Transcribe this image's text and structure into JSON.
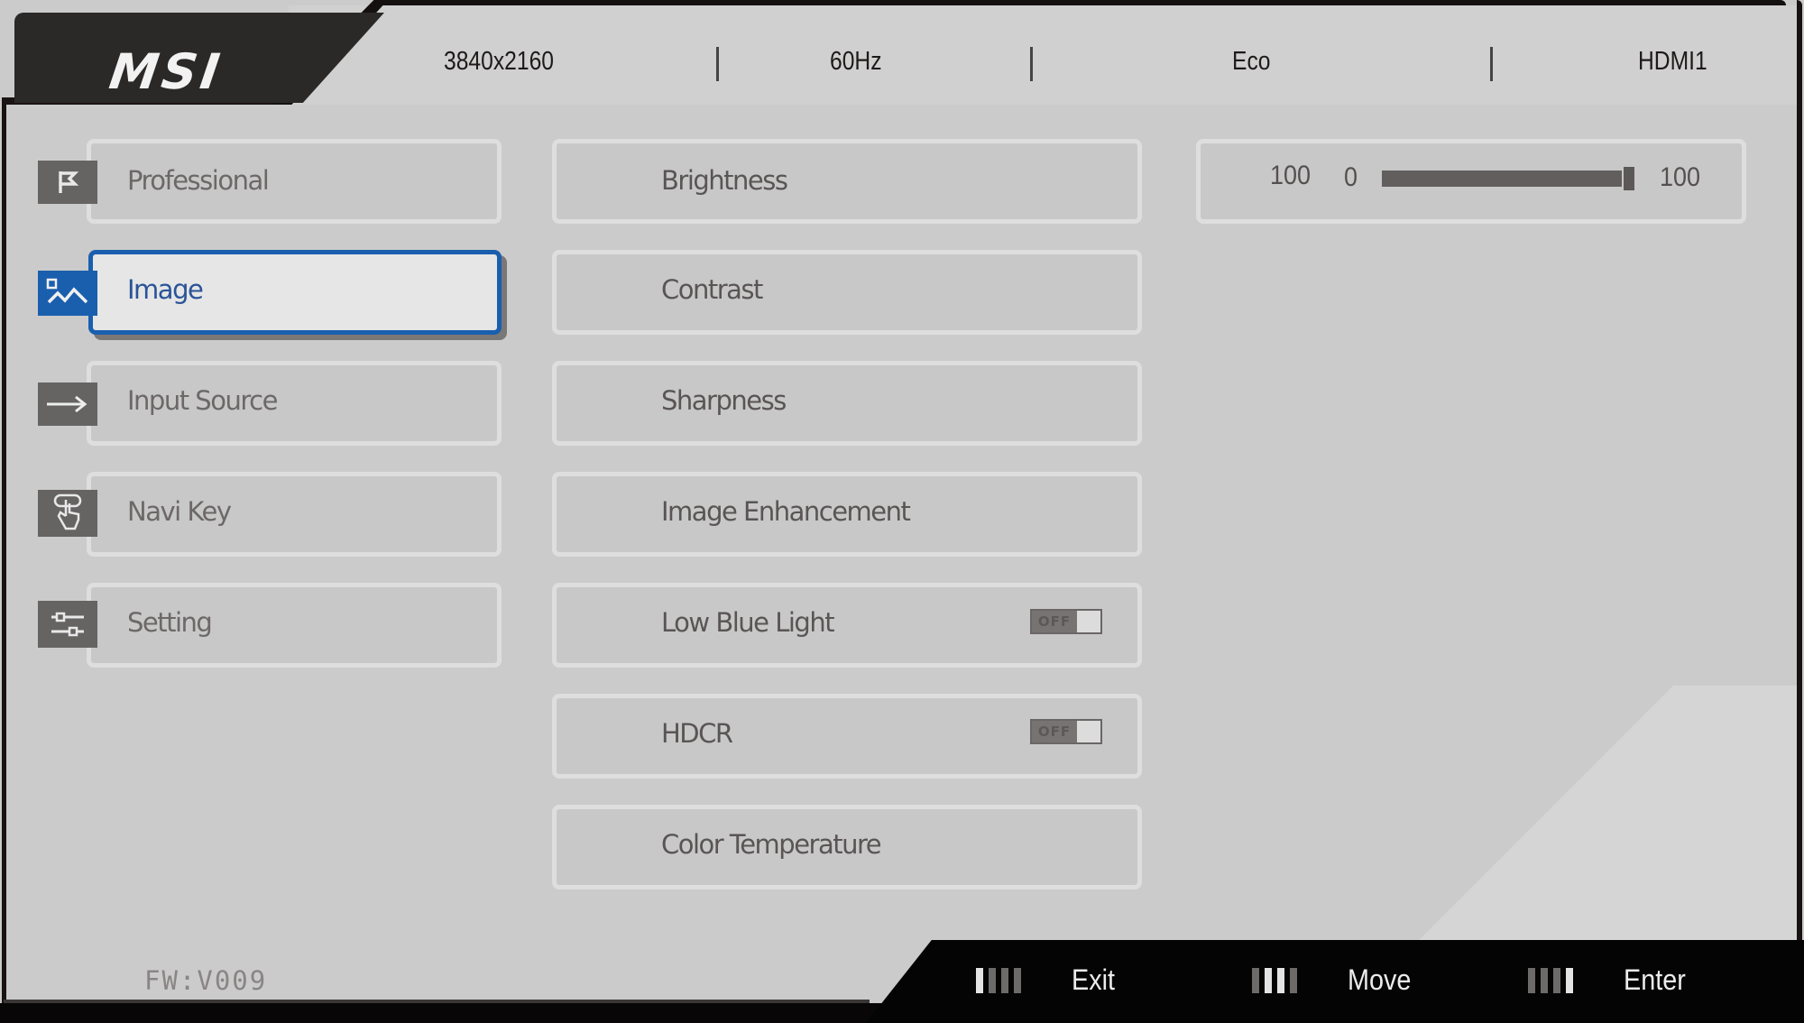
{
  "brand": {
    "logo_text": "MSI",
    "accent_color": "#1a5fae"
  },
  "status_bar": {
    "resolution": "3840x2160",
    "refresh_rate": "60Hz",
    "mode": "Eco",
    "input": "HDMI1"
  },
  "categories": [
    {
      "label": "Professional",
      "icon": "flag-icon",
      "active": false
    },
    {
      "label": "Image",
      "icon": "image-icon",
      "active": true
    },
    {
      "label": "Input Source",
      "icon": "arrow-right-icon",
      "active": false
    },
    {
      "label": "Navi Key",
      "icon": "touch-key-icon",
      "active": false
    },
    {
      "label": "Setting",
      "icon": "sliders-icon",
      "active": false
    }
  ],
  "submenu": [
    {
      "label": "Brightness"
    },
    {
      "label": "Contrast"
    },
    {
      "label": "Sharpness"
    },
    {
      "label": "Image Enhancement"
    },
    {
      "label": "Low Blue Light",
      "toggle": "OFF"
    },
    {
      "label": "HDCR",
      "toggle": "OFF"
    },
    {
      "label": "Color Temperature"
    }
  ],
  "value_panel": {
    "current": "100",
    "min": "0",
    "max": "100",
    "fraction": 1.0
  },
  "firmware": "FW:V009",
  "footer": {
    "hints": [
      {
        "label": "Exit",
        "lit": [
          true,
          false,
          false,
          false
        ]
      },
      {
        "label": "Move",
        "lit": [
          false,
          true,
          true,
          false
        ]
      },
      {
        "label": "Enter",
        "lit": [
          false,
          false,
          false,
          true
        ]
      }
    ]
  }
}
